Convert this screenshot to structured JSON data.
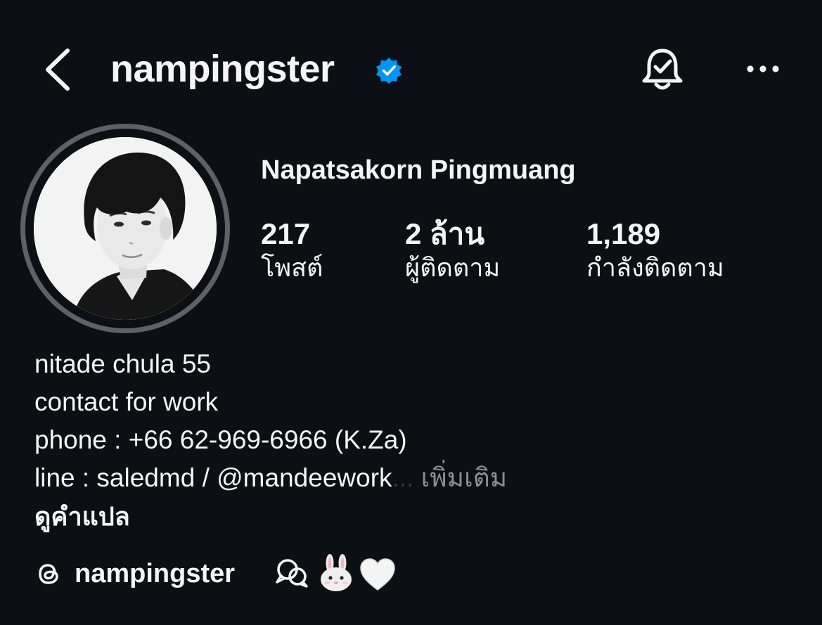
{
  "header": {
    "username": "nampingster",
    "verified": true,
    "icons": {
      "back": "chevron-left-icon",
      "verified": "verified-badge-icon",
      "notifications": "bell-check-icon",
      "more": "more-horizontal-icon"
    }
  },
  "profile": {
    "display_name": "Napatsakorn Pingmuang",
    "stats": {
      "posts": {
        "value": "217",
        "label": "โพสต์"
      },
      "followers": {
        "value": "2 ล้าน",
        "label": "ผู้ติดตาม"
      },
      "following": {
        "value": "1,189",
        "label": "กำลังติดตาม"
      }
    }
  },
  "bio": {
    "lines": [
      "nitade chula 55",
      "contact for work",
      "phone : +66 62-969-6966 (K.Za)",
      "line : saledmd / @mandeework"
    ],
    "ellipsis": "...",
    "more_label": "เพิ่มเติม",
    "translate_label": "ดูคำแปล"
  },
  "threads": {
    "handle": "nampingster",
    "icons": [
      "threads-logo-icon",
      "chat-bubble-icon",
      "bunny-emoji-icon",
      "white-heart-emoji-icon"
    ]
  },
  "colors": {
    "background": "#0c1014",
    "text": "#f5f5f5",
    "muted": "#8e8e93",
    "verified_blue": "#0095f6",
    "avatar_ring": "#5d6168"
  }
}
